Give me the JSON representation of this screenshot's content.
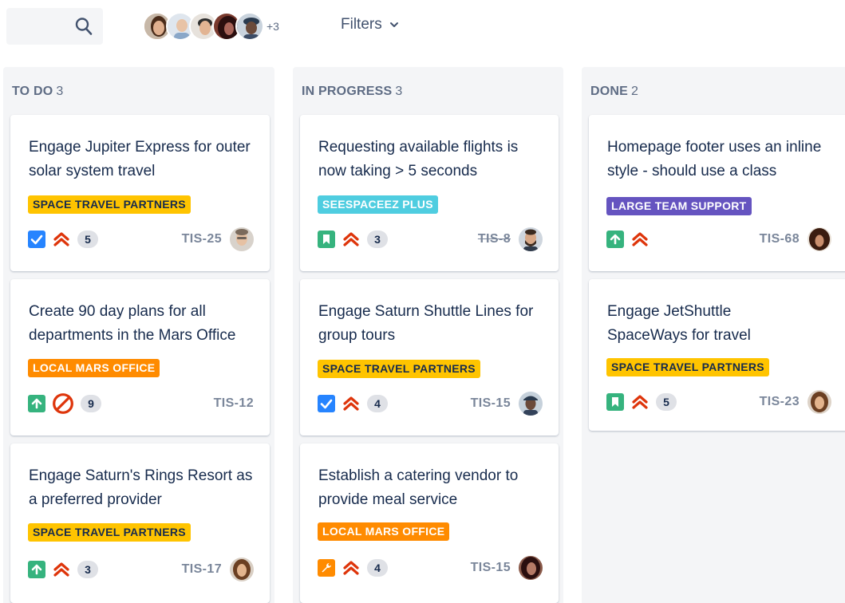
{
  "toolbar": {
    "search_icon": "search-icon",
    "avatars": [
      {
        "name": "avatar-1",
        "skin": "#d9a583",
        "hair": "#4a2c1a"
      },
      {
        "name": "avatar-2",
        "skin": "#e8c3a6",
        "hair": "#b9b9b9"
      },
      {
        "name": "avatar-3",
        "skin": "#e2b493",
        "hair": "#2d2d2d"
      },
      {
        "name": "avatar-4",
        "skin": "#a9655a",
        "hair": "#2b0f0f"
      },
      {
        "name": "avatar-5",
        "skin": "#6b4a3a",
        "hair": "#2a3a4e"
      }
    ],
    "more_count": "+3",
    "filters_label": "Filters"
  },
  "columns": [
    {
      "title": "TO DO",
      "count": "3",
      "cards": [
        {
          "title": "Engage Jupiter Express for outer solar system travel",
          "label": "SPACE TRAVEL PARTNERS",
          "label_color": "yellow",
          "type": "task",
          "priority": "highest",
          "estimate": "5",
          "key": "TIS-25",
          "key_strike": false,
          "assignee": "man-glasses"
        },
        {
          "title": "Create 90 day plans for all departments in the Mars Office",
          "label": "LOCAL MARS OFFICE",
          "label_color": "orange",
          "type": "improvement",
          "priority": "blocker",
          "estimate": "9",
          "key": "TIS-12",
          "key_strike": false,
          "assignee": ""
        },
        {
          "title": "Engage Saturn's Rings Resort as a preferred provider",
          "label": "SPACE TRAVEL PARTNERS",
          "label_color": "yellow",
          "type": "improvement",
          "priority": "highest",
          "estimate": "3",
          "key": "TIS-17",
          "key_strike": false,
          "assignee": "woman-brown"
        }
      ]
    },
    {
      "title": "IN PROGRESS",
      "count": "3",
      "cards": [
        {
          "title": "Requesting available flights is now taking > 5 seconds",
          "label": "SEESPACEEZ PLUS",
          "label_color": "teal",
          "type": "story",
          "priority": "highest",
          "estimate": "3",
          "key": "TIS-8",
          "key_strike": true,
          "assignee": "man-beard"
        },
        {
          "title": "Engage Saturn Shuttle Lines for group tours",
          "label": "SPACE TRAVEL PARTNERS",
          "label_color": "yellow",
          "type": "task",
          "priority": "highest",
          "estimate": "4",
          "key": "TIS-15",
          "key_strike": false,
          "assignee": "man-hat"
        },
        {
          "title": "Establish a catering vendor to provide meal service",
          "label": "LOCAL MARS OFFICE",
          "label_color": "orange",
          "type": "subtask",
          "priority": "highest",
          "estimate": "4",
          "key": "TIS-15",
          "key_strike": false,
          "assignee": "woman-dark"
        }
      ]
    },
    {
      "title": "DONE",
      "count": "2",
      "cards": [
        {
          "title": "Homepage footer uses an inline style - should use a class",
          "label": "LARGE TEAM SUPPORT",
          "label_color": "purple",
          "type": "improvement",
          "priority": "highest",
          "estimate": "",
          "key": "TIS-68",
          "key_strike": false,
          "assignee": "woman-curly"
        },
        {
          "title": "Engage JetShuttle SpaceWays for travel",
          "label": "SPACE TRAVEL PARTNERS",
          "label_color": "yellow",
          "type": "story",
          "priority": "highest",
          "estimate": "5",
          "key": "TIS-23",
          "key_strike": false,
          "assignee": "woman-brown"
        }
      ]
    }
  ],
  "colors": {
    "column_bg": "#F4F5F7",
    "priority_red": "#DE350B",
    "task_blue": "#2684FF",
    "story_green": "#36B37E",
    "subtask_orange": "#FF8B00"
  }
}
